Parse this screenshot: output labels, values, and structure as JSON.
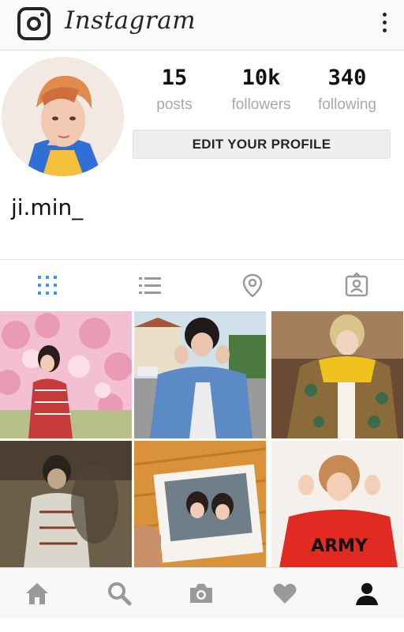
{
  "app": {
    "title": "Instagram"
  },
  "profile": {
    "username": "ji.min_",
    "edit_button_label": "EDIT YOUR PROFILE",
    "stats": {
      "posts": {
        "value": "15",
        "label": "posts"
      },
      "followers": {
        "value": "10k",
        "label": "followers"
      },
      "following": {
        "value": "340",
        "label": "following"
      }
    }
  },
  "tabs": [
    {
      "name": "grid",
      "icon": "grid-icon",
      "active": true
    },
    {
      "name": "list",
      "icon": "list-icon",
      "active": false
    },
    {
      "name": "map",
      "icon": "map-pin-icon",
      "active": false
    },
    {
      "name": "tagged",
      "icon": "tagged-person-icon",
      "active": false
    }
  ],
  "posts": [
    {
      "subject": "person among pink blossoms"
    },
    {
      "subject": "person in denim jacket outdoors"
    },
    {
      "subject": "person in patterned coat with yellow hood"
    },
    {
      "subject": "person in dim room"
    },
    {
      "subject": "hand holding polaroid photo"
    },
    {
      "subject": "person in red ARMY shirt"
    }
  ],
  "post_overlay_text": {
    "army_shirt": "ARMY"
  },
  "bottom_nav": [
    {
      "name": "home",
      "icon": "home-icon"
    },
    {
      "name": "search",
      "icon": "search-icon"
    },
    {
      "name": "camera",
      "icon": "camera-icon"
    },
    {
      "name": "activity",
      "icon": "heart-icon"
    },
    {
      "name": "profile",
      "icon": "profile-icon",
      "active": true
    }
  ],
  "colors": {
    "active_tab": "#3897f0",
    "inactive_icon": "#999999",
    "text_dark": "#262626",
    "label_gray": "#a8a8a8"
  }
}
